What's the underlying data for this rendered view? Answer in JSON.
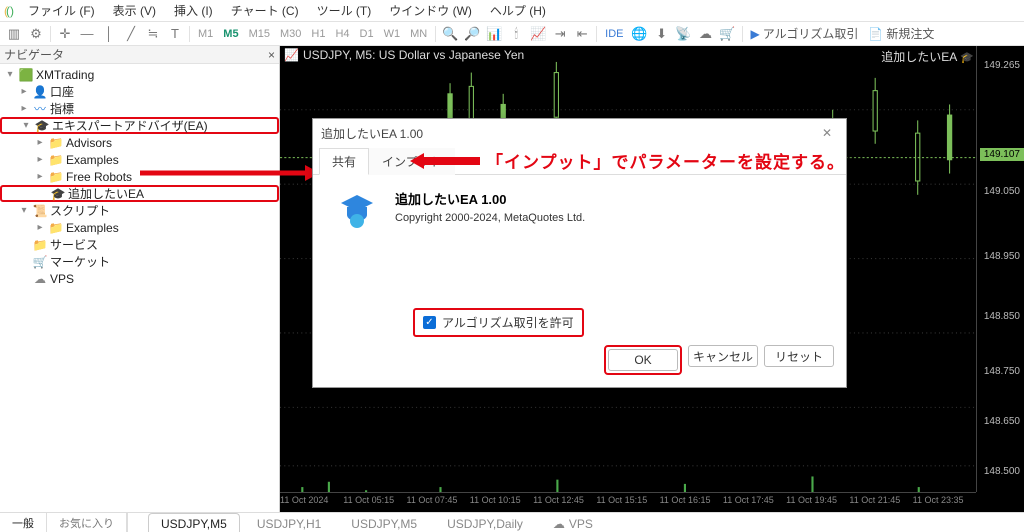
{
  "menu": {
    "items": [
      "ファイル (F)",
      "表示 (V)",
      "挿入 (I)",
      "チャート (C)",
      "ツール (T)",
      "ウインドウ (W)",
      "ヘルプ (H)"
    ]
  },
  "toolbar": {
    "timeframes": [
      "M1",
      "M5",
      "M15",
      "M30",
      "H1",
      "H4",
      "D1",
      "W1",
      "MN"
    ],
    "active_tf": "M5",
    "ide": "IDE",
    "algo_label": "アルゴリズム取引",
    "new_order": "新規注文"
  },
  "navigator": {
    "title": "ナビゲータ",
    "root": "XMTrading",
    "items": [
      {
        "icon": "account",
        "label": "口座"
      },
      {
        "icon": "wave",
        "label": "指標"
      }
    ],
    "ea_group": "エキスパートアドバイザ(EA)",
    "ea_children": [
      "Advisors",
      "Examples",
      "Free Robots"
    ],
    "ea_target": "追加したいEA",
    "script_group": "スクリプト",
    "script_children": [
      "Examples"
    ],
    "service": "サービス",
    "market": "マーケット",
    "vps": "VPS"
  },
  "chart": {
    "title": "USDJPY, M5: US Dollar vs Japanese Yen",
    "ea_name": "追加したいEA",
    "prices": [
      "149.265",
      "149.107",
      "149.050",
      "148.950",
      "148.850",
      "148.750",
      "148.650",
      "148.500"
    ],
    "current_price": "149.107",
    "times": [
      "11 Oct 2024",
      "11 Oct 05:15",
      "11 Oct 07:45",
      "11 Oct 10:15",
      "11 Oct 12:45",
      "11 Oct 15:15",
      "11 Oct 16:15",
      "11 Oct 17:45",
      "11 Oct 19:45",
      "11 Oct 21:45",
      "11 Oct 23:35"
    ]
  },
  "dialog": {
    "title": "追加したいEA 1.00",
    "tab_share": "共有",
    "tab_input": "インプット",
    "ea_title": "追加したいEA 1.00",
    "copyright": "Copyright 2000-2024, MetaQuotes Ltd.",
    "check_label": "アルゴリズム取引を許可",
    "ok": "OK",
    "cancel": "キャンセル",
    "reset": "リセット"
  },
  "annotation": "「インプット」でパラメーターを設定する。",
  "bottom": {
    "tabs": [
      "一般",
      "お気に入り"
    ],
    "symtabs": [
      "USDJPY,M5",
      "USDJPY,H1",
      "USDJPY,M5",
      "USDJPY,Daily"
    ],
    "vps": "VPS"
  }
}
